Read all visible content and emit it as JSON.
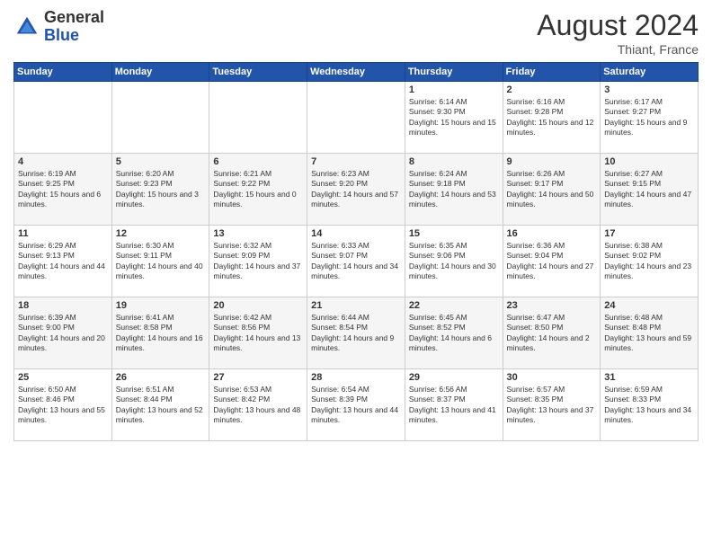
{
  "header": {
    "logo_general": "General",
    "logo_blue": "Blue",
    "month_year": "August 2024",
    "location": "Thiant, France"
  },
  "days_of_week": [
    "Sunday",
    "Monday",
    "Tuesday",
    "Wednesday",
    "Thursday",
    "Friday",
    "Saturday"
  ],
  "weeks": [
    [
      {
        "day": "",
        "info": ""
      },
      {
        "day": "",
        "info": ""
      },
      {
        "day": "",
        "info": ""
      },
      {
        "day": "",
        "info": ""
      },
      {
        "day": "1",
        "info": "Sunrise: 6:14 AM\nSunset: 9:30 PM\nDaylight: 15 hours and 15 minutes."
      },
      {
        "day": "2",
        "info": "Sunrise: 6:16 AM\nSunset: 9:28 PM\nDaylight: 15 hours and 12 minutes."
      },
      {
        "day": "3",
        "info": "Sunrise: 6:17 AM\nSunset: 9:27 PM\nDaylight: 15 hours and 9 minutes."
      }
    ],
    [
      {
        "day": "4",
        "info": "Sunrise: 6:19 AM\nSunset: 9:25 PM\nDaylight: 15 hours and 6 minutes."
      },
      {
        "day": "5",
        "info": "Sunrise: 6:20 AM\nSunset: 9:23 PM\nDaylight: 15 hours and 3 minutes."
      },
      {
        "day": "6",
        "info": "Sunrise: 6:21 AM\nSunset: 9:22 PM\nDaylight: 15 hours and 0 minutes."
      },
      {
        "day": "7",
        "info": "Sunrise: 6:23 AM\nSunset: 9:20 PM\nDaylight: 14 hours and 57 minutes."
      },
      {
        "day": "8",
        "info": "Sunrise: 6:24 AM\nSunset: 9:18 PM\nDaylight: 14 hours and 53 minutes."
      },
      {
        "day": "9",
        "info": "Sunrise: 6:26 AM\nSunset: 9:17 PM\nDaylight: 14 hours and 50 minutes."
      },
      {
        "day": "10",
        "info": "Sunrise: 6:27 AM\nSunset: 9:15 PM\nDaylight: 14 hours and 47 minutes."
      }
    ],
    [
      {
        "day": "11",
        "info": "Sunrise: 6:29 AM\nSunset: 9:13 PM\nDaylight: 14 hours and 44 minutes."
      },
      {
        "day": "12",
        "info": "Sunrise: 6:30 AM\nSunset: 9:11 PM\nDaylight: 14 hours and 40 minutes."
      },
      {
        "day": "13",
        "info": "Sunrise: 6:32 AM\nSunset: 9:09 PM\nDaylight: 14 hours and 37 minutes."
      },
      {
        "day": "14",
        "info": "Sunrise: 6:33 AM\nSunset: 9:07 PM\nDaylight: 14 hours and 34 minutes."
      },
      {
        "day": "15",
        "info": "Sunrise: 6:35 AM\nSunset: 9:06 PM\nDaylight: 14 hours and 30 minutes."
      },
      {
        "day": "16",
        "info": "Sunrise: 6:36 AM\nSunset: 9:04 PM\nDaylight: 14 hours and 27 minutes."
      },
      {
        "day": "17",
        "info": "Sunrise: 6:38 AM\nSunset: 9:02 PM\nDaylight: 14 hours and 23 minutes."
      }
    ],
    [
      {
        "day": "18",
        "info": "Sunrise: 6:39 AM\nSunset: 9:00 PM\nDaylight: 14 hours and 20 minutes."
      },
      {
        "day": "19",
        "info": "Sunrise: 6:41 AM\nSunset: 8:58 PM\nDaylight: 14 hours and 16 minutes."
      },
      {
        "day": "20",
        "info": "Sunrise: 6:42 AM\nSunset: 8:56 PM\nDaylight: 14 hours and 13 minutes."
      },
      {
        "day": "21",
        "info": "Sunrise: 6:44 AM\nSunset: 8:54 PM\nDaylight: 14 hours and 9 minutes."
      },
      {
        "day": "22",
        "info": "Sunrise: 6:45 AM\nSunset: 8:52 PM\nDaylight: 14 hours and 6 minutes."
      },
      {
        "day": "23",
        "info": "Sunrise: 6:47 AM\nSunset: 8:50 PM\nDaylight: 14 hours and 2 minutes."
      },
      {
        "day": "24",
        "info": "Sunrise: 6:48 AM\nSunset: 8:48 PM\nDaylight: 13 hours and 59 minutes."
      }
    ],
    [
      {
        "day": "25",
        "info": "Sunrise: 6:50 AM\nSunset: 8:46 PM\nDaylight: 13 hours and 55 minutes."
      },
      {
        "day": "26",
        "info": "Sunrise: 6:51 AM\nSunset: 8:44 PM\nDaylight: 13 hours and 52 minutes."
      },
      {
        "day": "27",
        "info": "Sunrise: 6:53 AM\nSunset: 8:42 PM\nDaylight: 13 hours and 48 minutes."
      },
      {
        "day": "28",
        "info": "Sunrise: 6:54 AM\nSunset: 8:39 PM\nDaylight: 13 hours and 44 minutes."
      },
      {
        "day": "29",
        "info": "Sunrise: 6:56 AM\nSunset: 8:37 PM\nDaylight: 13 hours and 41 minutes."
      },
      {
        "day": "30",
        "info": "Sunrise: 6:57 AM\nSunset: 8:35 PM\nDaylight: 13 hours and 37 minutes."
      },
      {
        "day": "31",
        "info": "Sunrise: 6:59 AM\nSunset: 8:33 PM\nDaylight: 13 hours and 34 minutes."
      }
    ]
  ]
}
